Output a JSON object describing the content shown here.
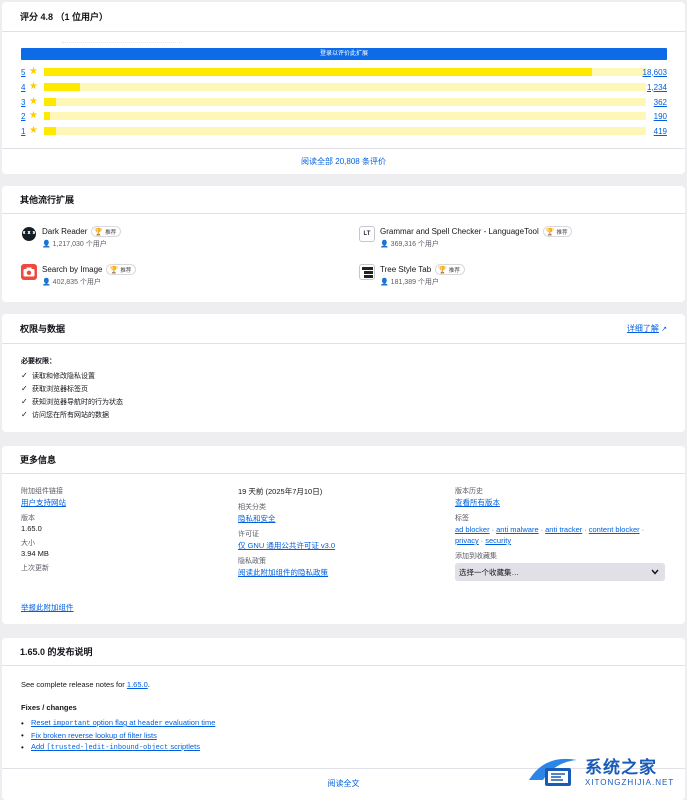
{
  "ratings": {
    "title": "评分 4.8 （1 位用户）",
    "login_label": "登录以评价此扩展",
    "rows": [
      {
        "stars": "5",
        "count": "18,603",
        "fraction": 0.91
      },
      {
        "stars": "4",
        "count": "1,234",
        "fraction": 0.06
      },
      {
        "stars": "3",
        "count": "362",
        "fraction": 0.02
      },
      {
        "stars": "2",
        "count": "190",
        "fraction": 0.01
      },
      {
        "stars": "1",
        "count": "419",
        "fraction": 0.02
      }
    ],
    "read_all": "阅读全部 20,808 条评价"
  },
  "popular": {
    "title": "其他流行扩展",
    "badge_label": "推荐",
    "items": [
      {
        "name": "Dark Reader",
        "users": "1,217,030 个用户",
        "icon": "dark-reader-icon",
        "icon_bg": "#ffffff",
        "icon_fg": "#141e24"
      },
      {
        "name": "Grammar and Spell Checker - LanguageTool",
        "users": "369,316 个用户",
        "icon": "languagetool-icon",
        "icon_bg": "#ffffff",
        "icon_fg": "#1f2d3d"
      },
      {
        "name": "Search by Image",
        "users": "402,835 个用户",
        "icon": "camera-icon",
        "icon_bg": "#ef4a3c",
        "icon_fg": "#ffffff"
      },
      {
        "name": "Tree Style Tab",
        "users": "181,389 个用户",
        "icon": "tree-tab-icon",
        "icon_bg": "#ffffff",
        "icon_fg": "#222222"
      }
    ]
  },
  "permissions": {
    "title": "权限与数据",
    "learn_more": "详细了解",
    "required_label": "必要权限：",
    "items": [
      "读取和修改隐私设置",
      "获取浏览器标签页",
      "获知浏览器导航时的行为状态",
      "访问您在所有网站的数据"
    ]
  },
  "info": {
    "title": "更多信息",
    "addon_links_label": "附加组件链接",
    "support_site": "用户支持网站",
    "version_label": "版本",
    "version": "1.65.0",
    "size_label": "大小",
    "size": "3.94 MB",
    "last_updated_label": "上次更新",
    "last_updated": "19 天前 (2025年7月10日)",
    "categories_label": "相关分类",
    "category": "隐私和安全",
    "license_label": "许可证",
    "license": "仅 GNU 通用公共许可证 v3.0",
    "privacy_label": "隐私政策",
    "privacy_link": "阅读此附加组件的隐私政策",
    "history_label": "版本历史",
    "history_link": "查看所有版本",
    "tags_label": "标签",
    "tags": [
      "ad blocker",
      "anti malware",
      "anti tracker",
      "content blocker",
      "privacy",
      "security"
    ],
    "collection_label": "添加到收藏集",
    "collection_select": "选择一个收藏集…",
    "report": "举报此附加组件"
  },
  "release": {
    "title": "1.65.0 的发布说明",
    "see_prefix": "See complete release notes for ",
    "see_link": "1.65.0",
    "see_suffix": ".",
    "fixes_label": "Fixes / changes",
    "items": [
      {
        "pre": "Reset ",
        "code": "important",
        "mid": " option flag at ",
        "code2": "header",
        "post": " evaluation time"
      },
      {
        "pre": "Fix broken reverse lookup of filter lists",
        "code": "",
        "mid": "",
        "code2": "",
        "post": ""
      },
      {
        "pre": "Add ",
        "code": "[trusted-]edit-inbound-object",
        "mid": " scriptlets",
        "code2": "",
        "post": ""
      }
    ],
    "read_full": "阅读全文"
  },
  "watermark": {
    "cn": "系统之家",
    "en": "XITONGZHIJIA.NET"
  },
  "colors": {
    "accent": "#0060df",
    "star": "#ffcc00",
    "bar_fill": "#ffe900",
    "bar_track": "#fff7b8",
    "login_bar": "#0d6be8"
  }
}
